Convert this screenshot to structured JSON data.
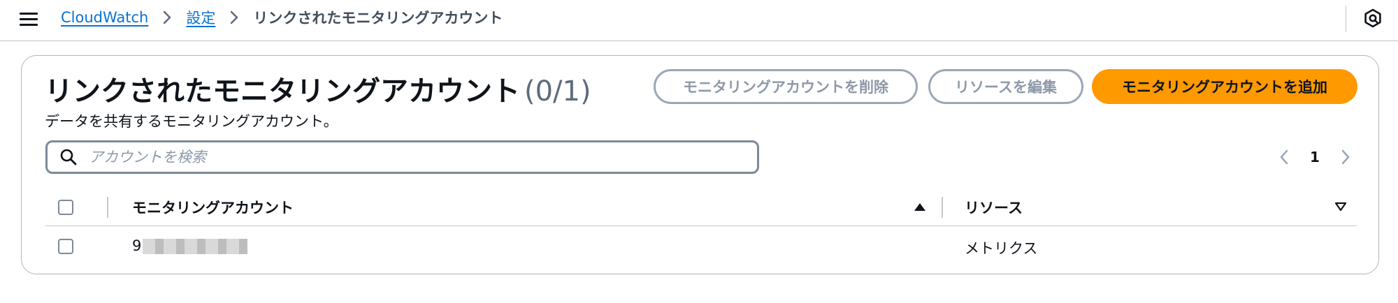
{
  "breadcrumb": {
    "items": [
      "CloudWatch",
      "設定"
    ],
    "current": "リンクされたモニタリングアカウント"
  },
  "panel": {
    "title": "リンクされたモニタリングアカウント",
    "count": "(0/1)",
    "description": "データを共有するモニタリングアカウント。",
    "buttons": {
      "delete": "モニタリングアカウントを削除",
      "edit": "リソースを編集",
      "add": "モニタリングアカウントを追加"
    },
    "search": {
      "placeholder": "アカウントを検索",
      "value": ""
    },
    "pagination": {
      "current_page": "1"
    },
    "table": {
      "columns": [
        "モニタリングアカウント",
        "リソース"
      ],
      "rows": [
        {
          "account": "9",
          "account_redacted": true,
          "resources": "メトリクス"
        }
      ]
    }
  },
  "icons": {
    "menu": "hamburger-icon",
    "help": "help-icon",
    "search": "search-icon",
    "breadcrumb_separator": "chevron-right-icon",
    "sort_ascending": "caret-up-filled-icon",
    "sort_none": "caret-down-icon"
  },
  "colors": {
    "link": "#0972d3",
    "primary_button": "#ff9900",
    "disabled_text": "#8d99a8",
    "border": "#c6c6cd"
  }
}
